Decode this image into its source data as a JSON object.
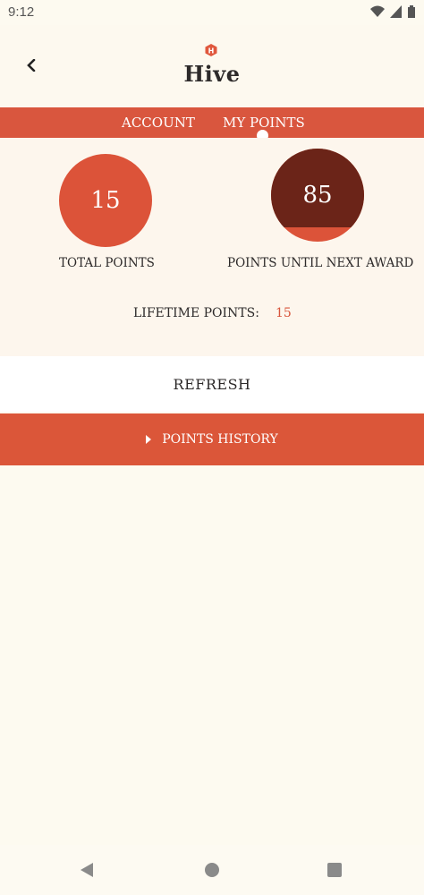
{
  "status_bar": {
    "time": "9:12",
    "icons": [
      "wifi-icon",
      "signal-icon",
      "battery-icon"
    ]
  },
  "header": {
    "title": "Hive",
    "back_icon": "chevron-left-icon",
    "logo_icon": "hive-logo-mark",
    "logo_letter": "H"
  },
  "tabs": [
    {
      "label": "ACCOUNT",
      "active": false
    },
    {
      "label": "MY POINTS",
      "active": true
    }
  ],
  "points": {
    "total": "15",
    "total_label": "TOTAL POINTS",
    "until_next": "85",
    "until_next_label": "POINTS UNTIL NEXT AWARD",
    "progress_fraction_remaining": 0.85,
    "lifetime_label": "LIFETIME POINTS:",
    "lifetime_value": "15"
  },
  "actions": {
    "refresh_label": "REFRESH",
    "history_label": "POINTS HISTORY"
  },
  "colors": {
    "accent": "#d9563e",
    "dark_accent": "#6b2418",
    "background": "#fdfaf0"
  }
}
